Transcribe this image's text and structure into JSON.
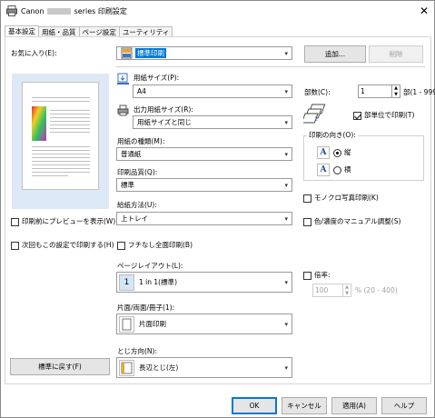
{
  "window": {
    "title_prefix": "Canon",
    "title_suffix": "series 印刷設定",
    "close_glyph": "✕"
  },
  "tabs": [
    {
      "label": "基本設定"
    },
    {
      "label": "用紙・品質"
    },
    {
      "label": "ページ設定"
    },
    {
      "label": "ユーティリティ"
    }
  ],
  "favorites": {
    "label": "お気に入り(E):",
    "value": "標準印刷",
    "add_button": "追加...",
    "delete_button": "削除"
  },
  "left": {
    "preview_checkbox": "印刷前にプレビューを表示(W)",
    "remember_checkbox": "次回もこの設定で印刷する(H)",
    "defaults_button": "標準に戻す(F)"
  },
  "paper_size": {
    "label": "用紙サイズ(P):",
    "value": "A4"
  },
  "output_size": {
    "label": "出力用紙サイズ(R):",
    "value": "用紙サイズと同じ"
  },
  "media_type": {
    "label": "用紙の種類(M):",
    "value": "普通紙"
  },
  "quality": {
    "label": "印刷品質(Q):",
    "value": "標準"
  },
  "source": {
    "label": "給紙方法(U):",
    "value": "上トレイ"
  },
  "borderless": {
    "label": "フチなし全面印刷(B)"
  },
  "layout": {
    "label": "ページレイアウト(L):",
    "value": "1 in 1(標準)",
    "icon_text": "1"
  },
  "duplex": {
    "label": "片面/両面/冊子(1):",
    "value": "片面印刷"
  },
  "binding": {
    "label": "とじ方向(N):",
    "value": "長辺とじ(左)"
  },
  "copies": {
    "label": "部数(C):",
    "value": "1",
    "range": "部(1 - 999)",
    "collate_label": "部単位で印刷(T)"
  },
  "orientation": {
    "group_label": "印刷の向き(O):",
    "portrait": "縦",
    "landscape": "横",
    "icon_text": "A"
  },
  "options": {
    "mono_photo": "モノクロ写真印刷(K)",
    "color_manual": "色/濃度のマニュアル調整(S)"
  },
  "scale": {
    "label": "倍率:",
    "value": "100",
    "range": "% (20 - 400)"
  },
  "bottom": {
    "ok": "OK",
    "cancel": "キャンセル",
    "apply": "適用(A)",
    "help": "ヘルプ"
  }
}
